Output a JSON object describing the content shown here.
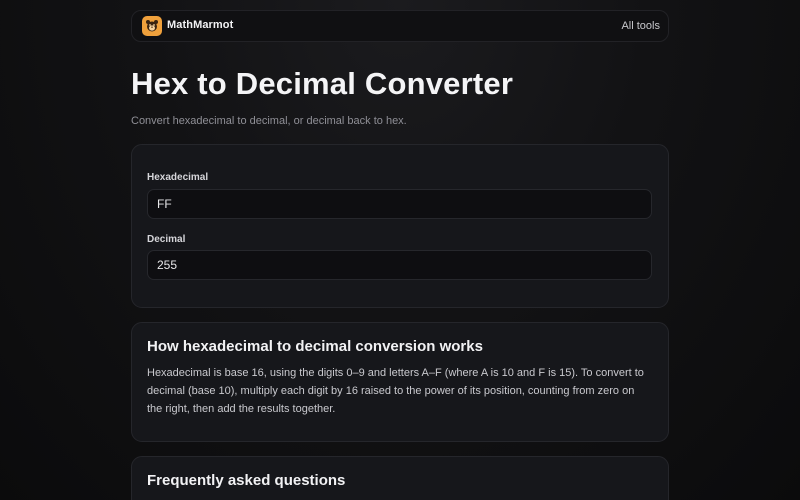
{
  "header": {
    "brand": "MathMarmot",
    "logo_icon": "marmot-icon",
    "nav_link": "All tools"
  },
  "page": {
    "title": "Hex to Decimal Converter",
    "subtitle": "Convert hexadecimal to decimal, or decimal back to hex."
  },
  "converter": {
    "hex_label": "Hexadecimal",
    "hex_value": "FF",
    "dec_label": "Decimal",
    "dec_value": "255"
  },
  "how": {
    "heading": "How hexadecimal to decimal conversion works",
    "text": "Hexadecimal is base 16, using the digits 0–9 and letters A–F (where A is 10 and F is 15). To convert to decimal (base 10), multiply each digit by 16 raised to the power of its position, counting from zero on the right, then add the results together."
  },
  "faq": {
    "heading": "Frequently asked questions"
  },
  "colors": {
    "accent": "#f0a13c",
    "background": "#0d0d0e",
    "card": "#16171b"
  }
}
